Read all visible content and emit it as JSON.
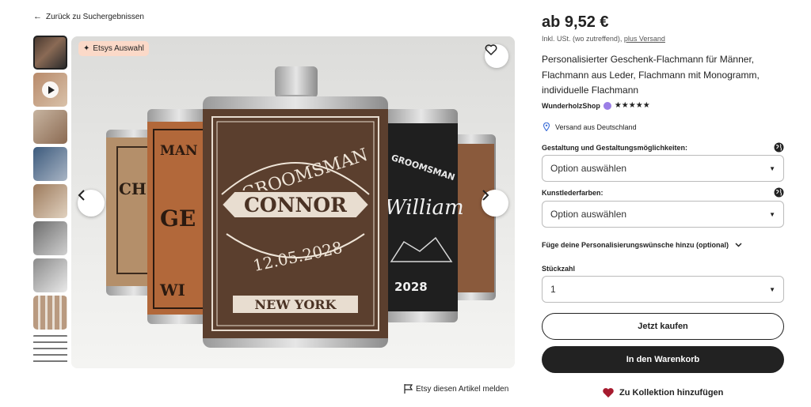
{
  "nav": {
    "back_label": "Zurück zu Suchergebnissen"
  },
  "gallery": {
    "badge_label": "Etsys Auswahl",
    "report_label": "Etsy diesen Artikel melden",
    "flask_main_text": {
      "top": "GROOMSMAN",
      "name": "CONNOR",
      "date": "12.05.2028",
      "city": "NEW YORK"
    },
    "flask_right_text": {
      "top": "GROOMSMAN",
      "name": "William",
      "year": "2028"
    },
    "flask_left_text": {
      "a": "MAN",
      "b": "GE",
      "c": "WI",
      "d": "CH"
    }
  },
  "product": {
    "price": "ab 9,52 €",
    "tax_note": "Inkl. USt. (wo zutreffend),",
    "shipping_link": "plus Versand",
    "title": "Personalisierter Geschenk-Flachmann für Männer, Flachmann aus Leder, Flachmann mit Monogramm, individuelle Flachmann",
    "shop_name": "WunderholzShop",
    "stars": "★★★★★",
    "ships_from": "Versand aus Deutschland"
  },
  "options": {
    "design_label": "Gestaltung und Gestaltungsmöglichkeiten:",
    "design_value": "Option auswählen",
    "color_label": "Kunstlederfarben:",
    "color_value": "Option auswählen",
    "personalize_label": "Füge deine Personalisierungswünsche hinzu (optional)",
    "quantity_label": "Stückzahl",
    "quantity_value": "1"
  },
  "actions": {
    "buy_now": "Jetzt kaufen",
    "add_to_cart": "In den Warenkorb",
    "add_to_collection": "Zu Kollektion hinzufügen"
  },
  "colors": {
    "cart_button": "#222222",
    "badge_bg": "#fbd9c8",
    "heart": "#a61a2e"
  }
}
